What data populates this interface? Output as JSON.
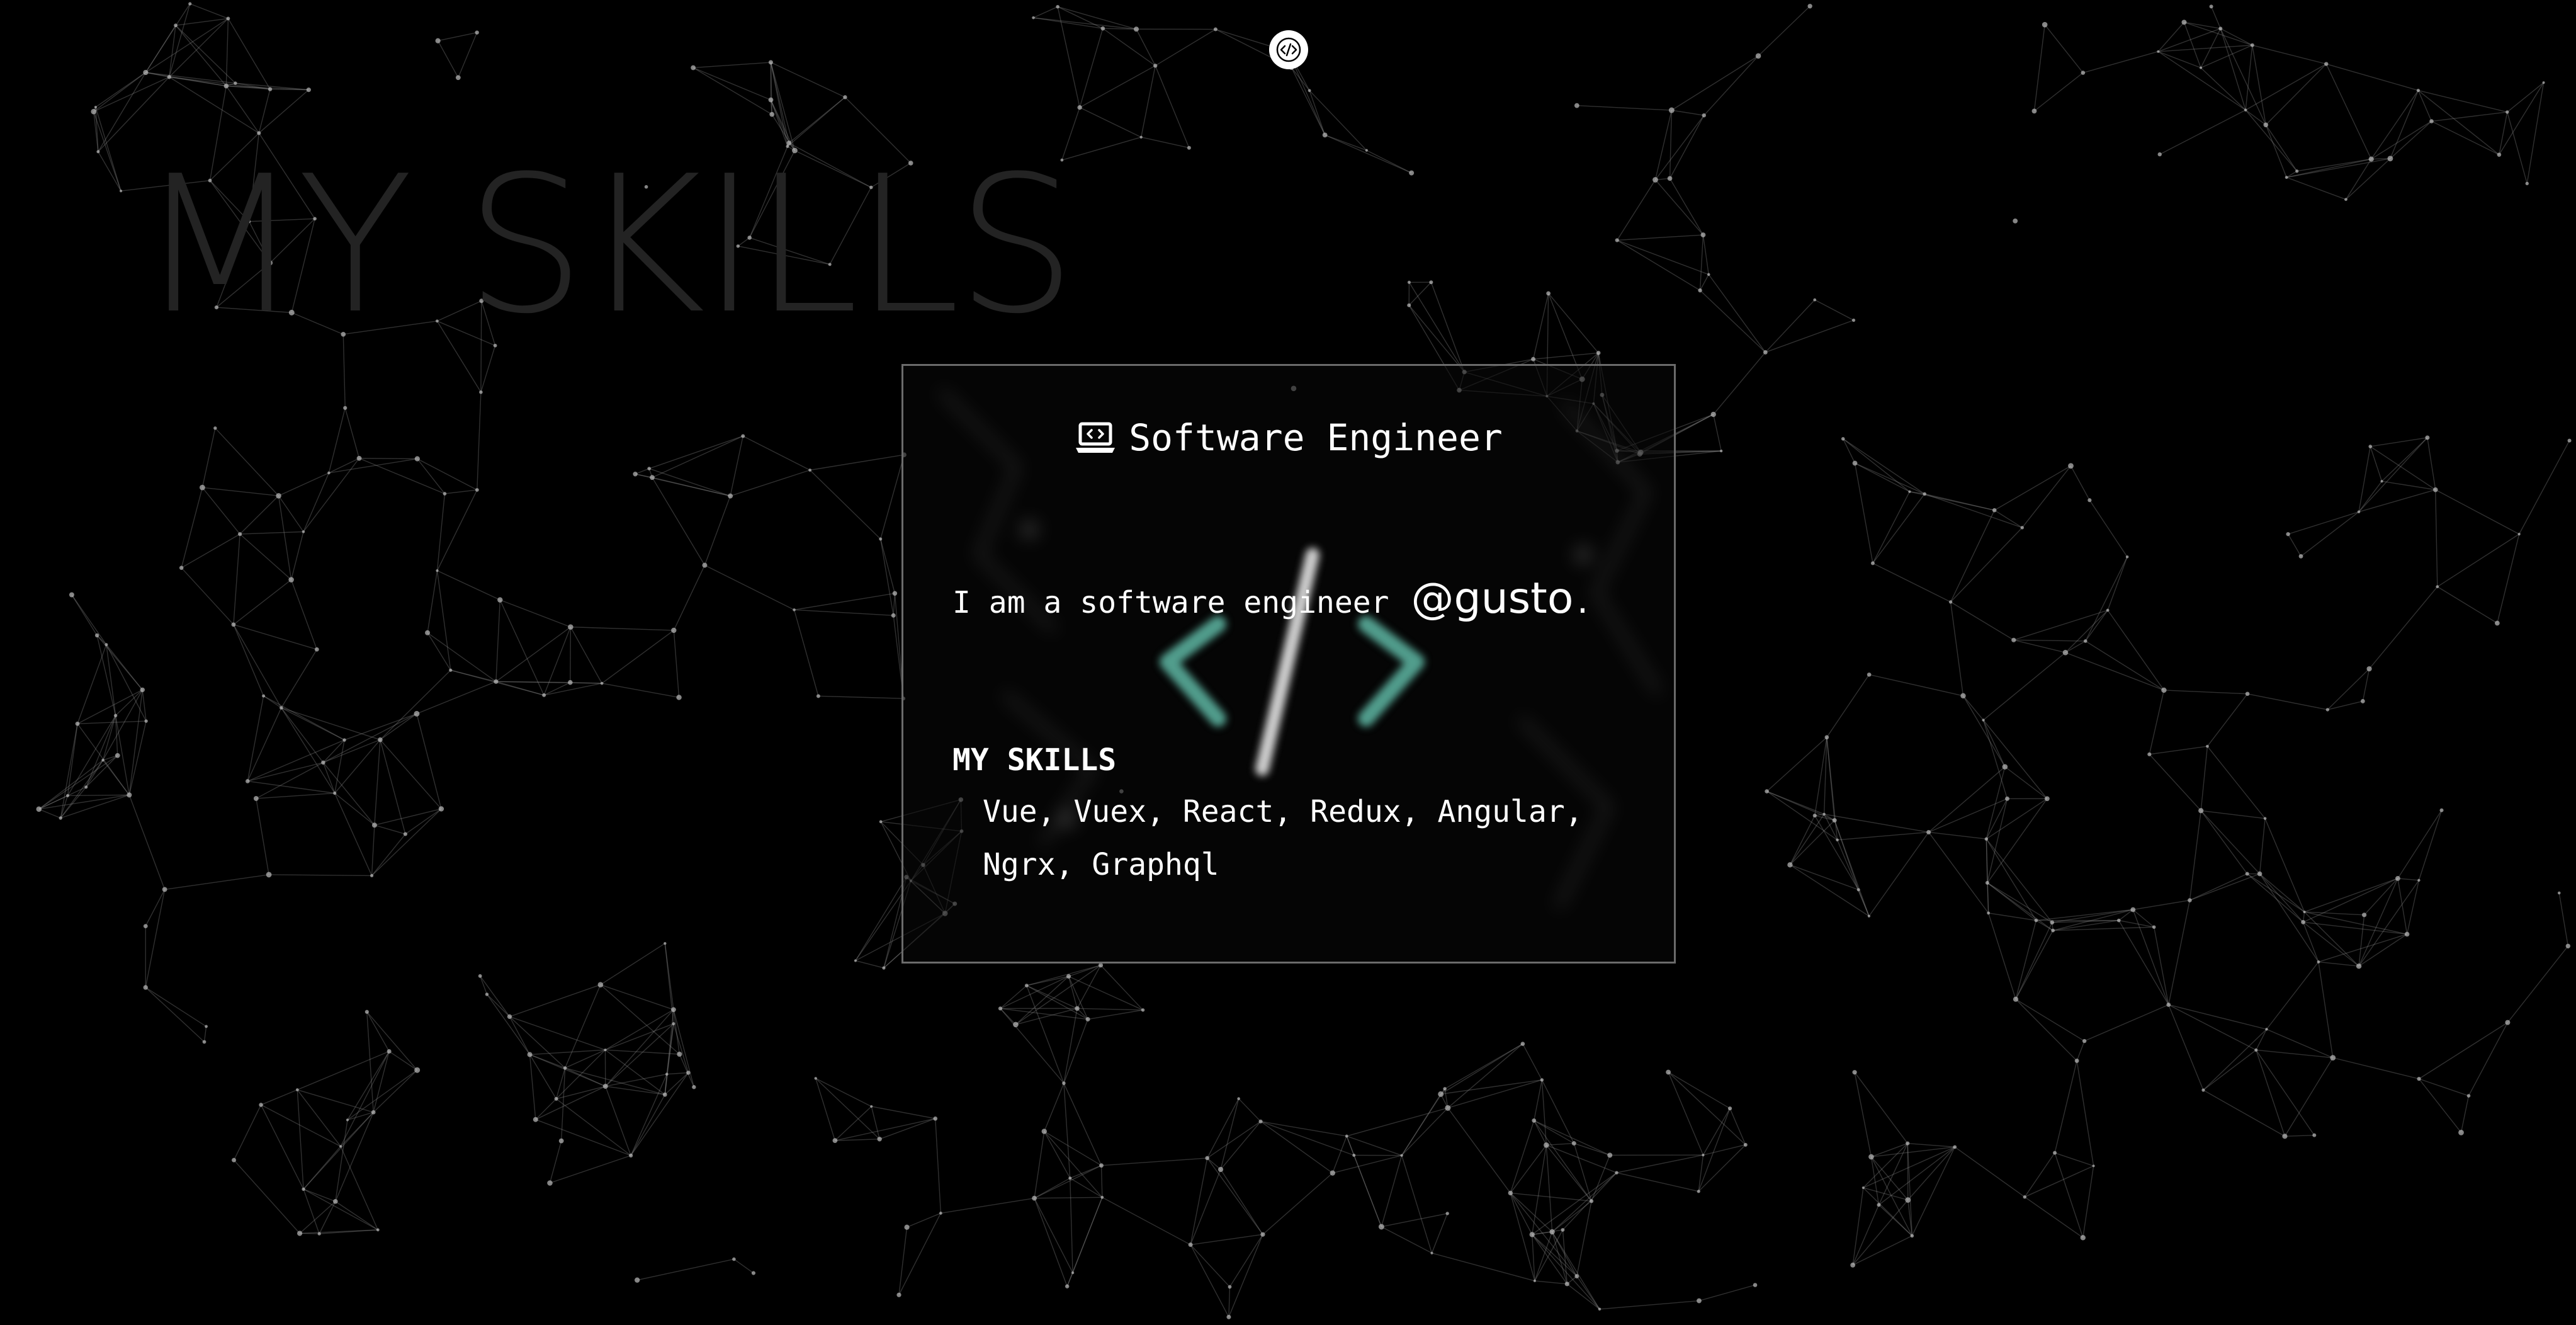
{
  "background": {
    "title": "MY SKILLS",
    "color": "#000000",
    "network_color": "#8a8a8a"
  },
  "logo": {
    "icon": "code-icon",
    "aria": "code logo"
  },
  "card": {
    "title": "Software Engineer",
    "title_icon": "laptop-code-icon",
    "intro_text": "I am a software engineer",
    "company": "@gusto",
    "company_suffix": ".",
    "skills_heading": "MY SKILLS",
    "skills_line1": "Vue, Vuex, React, Redux, Angular,",
    "skills_line2": "Ngrx, Graphql",
    "accent_color": "#5fb8a6"
  }
}
